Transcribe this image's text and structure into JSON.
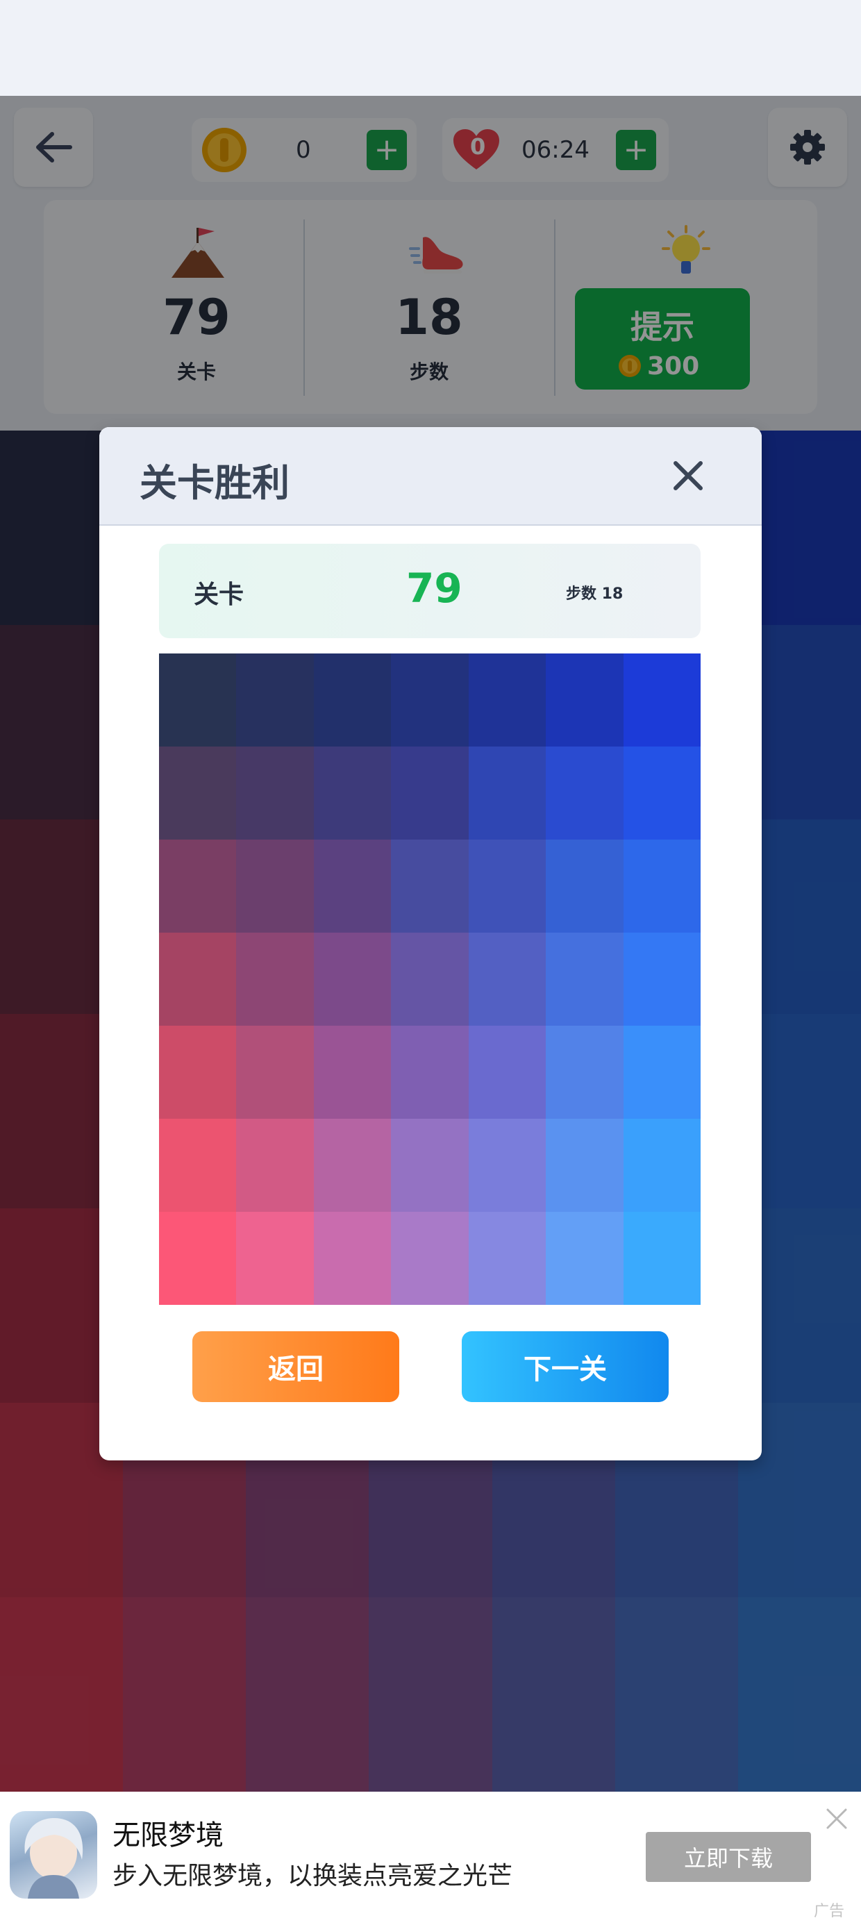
{
  "header": {
    "coins": {
      "value": "0",
      "plus": "+"
    },
    "lives": {
      "count": "0",
      "timer": "06:24",
      "plus": "+"
    }
  },
  "stats": {
    "level": {
      "value": "79",
      "label": "关卡"
    },
    "steps": {
      "value": "18",
      "label": "步数"
    },
    "hint": {
      "label": "提示",
      "cost": "300"
    }
  },
  "modal": {
    "title": "关卡胜利",
    "info": {
      "level_label": "关卡",
      "level_value": "79",
      "steps_text": "步数 18"
    },
    "buttons": {
      "back": "返回",
      "next": "下一关"
    }
  },
  "ad": {
    "title": "无限梦境",
    "description": "步入无限梦境，以换装点亮爱之光芒",
    "cta": "立即下载",
    "tag": "广告"
  },
  "colors": {
    "green": "#12b24d",
    "orange": "#ff8a2a",
    "blue": "#1a9bf5",
    "solved_grid": [
      [
        "#283352",
        "#27315f",
        "#22306b",
        "#22327e",
        "#1f3397",
        "#1c35b5",
        "#1c3bd8"
      ],
      [
        "#4a3a5c",
        "#473966",
        "#3d3a7a",
        "#373b8c",
        "#2f46b3",
        "#2a4bd0",
        "#2452e6"
      ],
      [
        "#7a3e64",
        "#6b3f6d",
        "#5b4180",
        "#474c9f",
        "#3f52b8",
        "#3561d4",
        "#2d68ea"
      ],
      [
        "#a54463",
        "#8d4674",
        "#7c4a8a",
        "#6555a5",
        "#5360c3",
        "#4570de",
        "#3478f4"
      ],
      [
        "#cd4c68",
        "#b15079",
        "#9a5495",
        "#7f5fb2",
        "#6a6acf",
        "#5282e8",
        "#3a8ffa"
      ],
      [
        "#ec5470",
        "#d25a85",
        "#b564a3",
        "#9472c3",
        "#7a7ddb",
        "#5a92f0",
        "#3aa0fc"
      ],
      [
        "#fc5777",
        "#ee6390",
        "#c96cae",
        "#a97ac8",
        "#8688e1",
        "#639ff6",
        "#3aaafd"
      ]
    ],
    "board": [
      [
        "#2a2f4a",
        "#27315f",
        "#23336f",
        "#22357c",
        "#213890",
        "#1f3aa6",
        "#1a3ab8"
      ],
      [
        "#4a3048",
        "#423560",
        "#3b3a74",
        "#343d86",
        "#2f4598",
        "#2a4aac",
        "#2550be"
      ],
      [
        "#6a2e42",
        "#5a3660",
        "#4c3e78",
        "#3e4690",
        "#344ea6",
        "#2d56b8",
        "#2660c6"
      ],
      [
        "#8a2e44",
        "#763662",
        "#60407e",
        "#4c4a98",
        "#3d54ae",
        "#325cc0",
        "#2a66cc"
      ],
      [
        "#a83048",
        "#923a62",
        "#78447c",
        "#5e5096",
        "#4858ac",
        "#3a62bc",
        "#2e6cca"
      ],
      [
        "#c2364e",
        "#aa3e66",
        "#8c487e",
        "#6e5498",
        "#565eae",
        "#4468c0",
        "#3474ce"
      ],
      [
        "#cf3a54",
        "#b8426a",
        "#9a4c82",
        "#7a589a",
        "#5e64b2",
        "#4a70c4",
        "#387cd2"
      ]
    ]
  }
}
